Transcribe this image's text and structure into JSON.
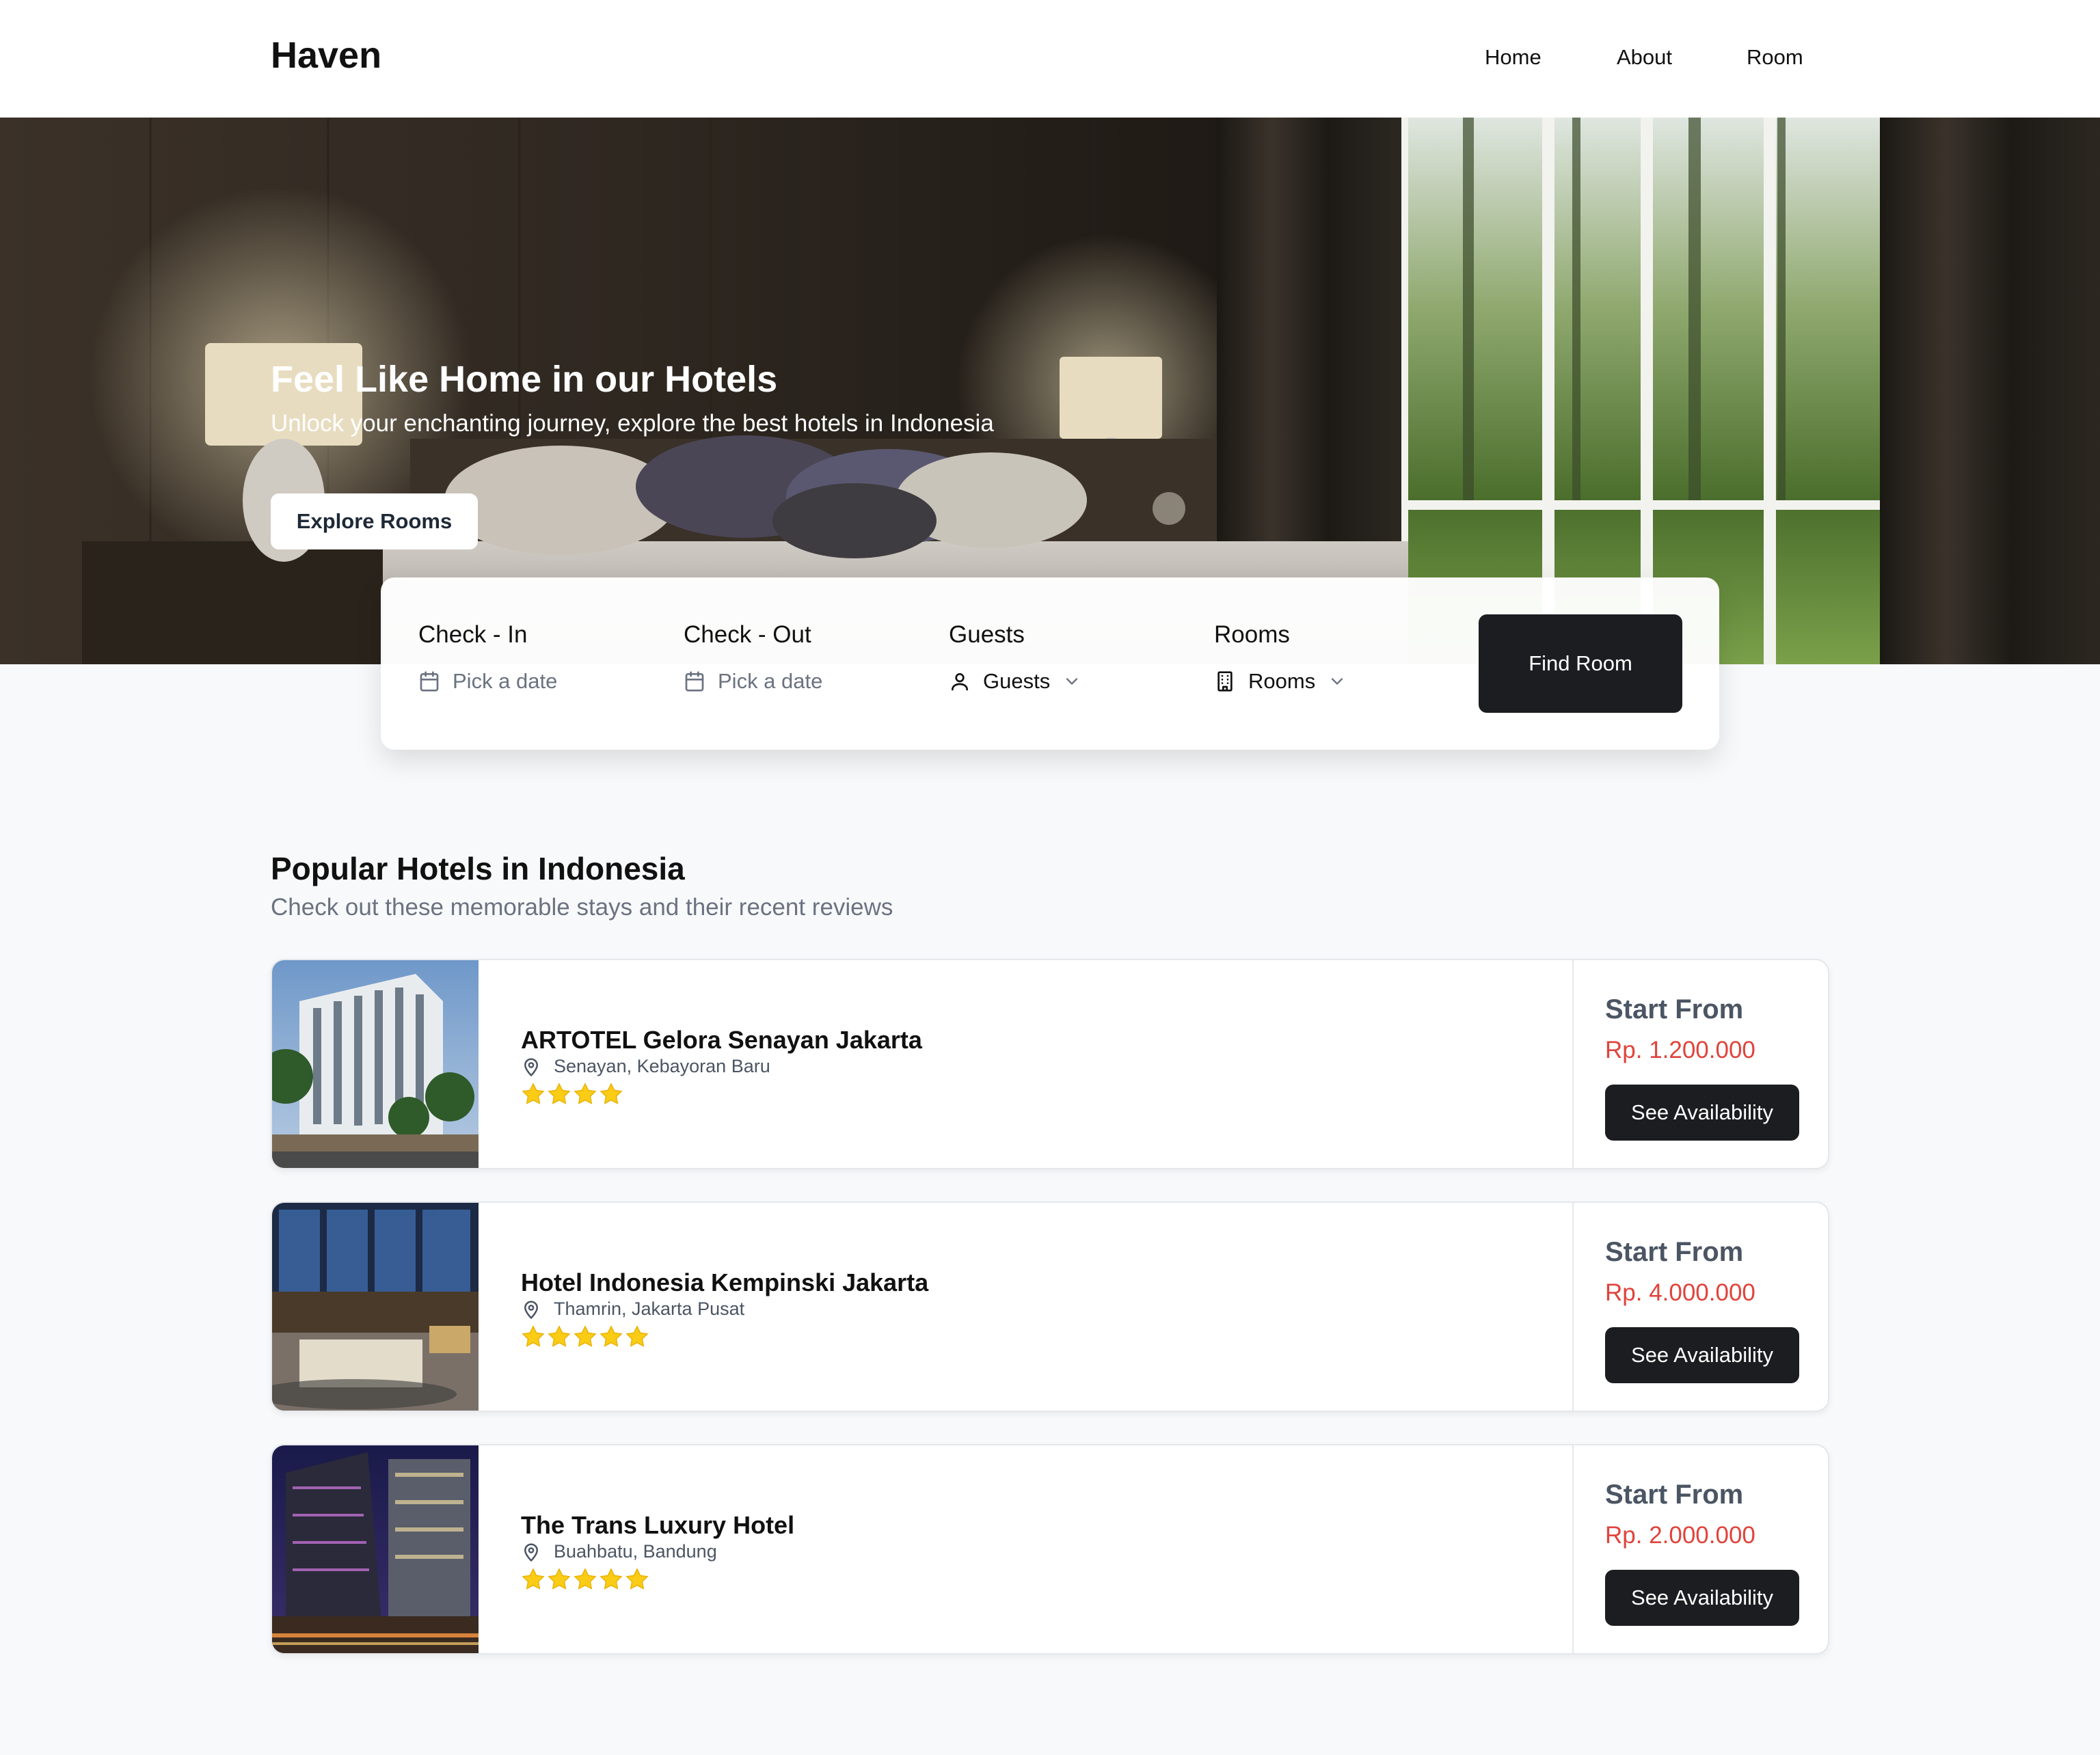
{
  "nav": {
    "brand": "Haven",
    "links": [
      "Home",
      "About",
      "Room"
    ]
  },
  "hero": {
    "title": "Feel Like Home in our Hotels",
    "subtitle": "Unlock your enchanting journey, explore the best hotels in Indonesia",
    "cta_label": "Explore Rooms"
  },
  "search": {
    "checkin": {
      "label": "Check - In",
      "placeholder": "Pick a date",
      "icon": "calendar-icon"
    },
    "checkout": {
      "label": "Check - Out",
      "placeholder": "Pick a date",
      "icon": "calendar-icon"
    },
    "guests": {
      "label": "Guests",
      "value": "Guests",
      "icon": "user-icon"
    },
    "rooms": {
      "label": "Rooms",
      "value": "Rooms",
      "icon": "building-icon"
    },
    "submit_label": "Find Room"
  },
  "popular": {
    "title": "Popular Hotels in Indonesia",
    "subtitle": "Check out these memorable stays and their recent reviews",
    "hotels": [
      {
        "name": "ARTOTEL Gelora Senayan Jakarta",
        "location": "Senayan, Kebayoran Baru",
        "rating": 4,
        "start_label": "Start From",
        "price": "Rp. 1.200.000",
        "button_label": "See Availability"
      },
      {
        "name": "Hotel Indonesia Kempinski Jakarta",
        "location": "Thamrin, Jakarta Pusat",
        "rating": 5,
        "start_label": "Start From",
        "price": "Rp. 4.000.000",
        "button_label": "See Availability"
      },
      {
        "name": "The Trans Luxury Hotel",
        "location": "Buahbatu, Bandung",
        "rating": 5,
        "start_label": "Start From",
        "price": "Rp. 2.000.000",
        "button_label": "See Availability"
      }
    ]
  },
  "colors": {
    "accent_dark": "#1c1d20",
    "price_red": "#e0433c",
    "star_yellow": "#facc15",
    "page_bg": "#f8f9fb"
  }
}
